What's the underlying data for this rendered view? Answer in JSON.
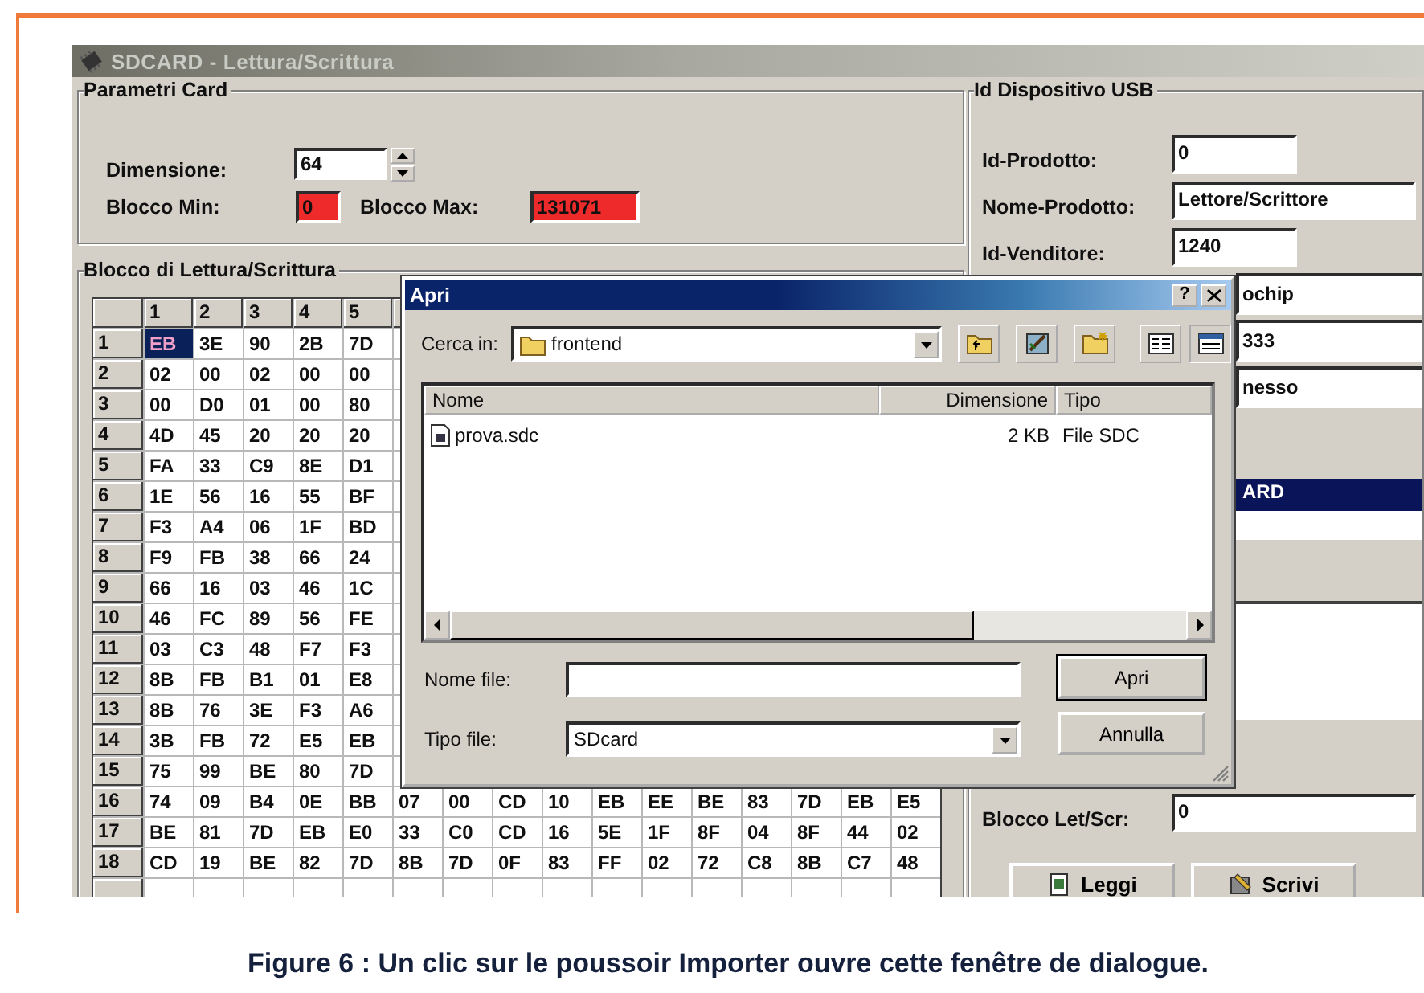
{
  "window": {
    "title": "SDCARD - Lettura/Scrittura"
  },
  "card_params": {
    "title": "Parametri Card",
    "fields": [
      {
        "kind": "spin",
        "label": "Dimensione:",
        "value": "64"
      },
      {
        "kind": "alert",
        "label": "Blocco Min:",
        "value": "0"
      },
      {
        "kind": "alert",
        "label": "Blocco Max:",
        "value": "131071"
      }
    ]
  },
  "data_block": {
    "title": "Blocco di Lettura/Scrittura",
    "columns": [
      "1",
      "2",
      "3",
      "4",
      "5"
    ],
    "rows": [
      {
        "label": "1",
        "cells": [
          "EB",
          "3E",
          "90",
          "2B",
          "7D"
        ],
        "selected": [
          true,
          false,
          false,
          false,
          false
        ]
      },
      {
        "label": "2",
        "cells": [
          "02",
          "00",
          "02",
          "00",
          "00"
        ]
      },
      {
        "label": "3",
        "cells": [
          "00",
          "D0",
          "01",
          "00",
          "80"
        ]
      },
      {
        "label": "4",
        "cells": [
          "4D",
          "45",
          "20",
          "20",
          "20"
        ]
      },
      {
        "label": "5",
        "cells": [
          "FA",
          "33",
          "C9",
          "8E",
          "D1"
        ]
      },
      {
        "label": "6",
        "cells": [
          "1E",
          "56",
          "16",
          "55",
          "BF"
        ]
      },
      {
        "label": "7",
        "cells": [
          "F3",
          "A4",
          "06",
          "1F",
          "BD"
        ]
      },
      {
        "label": "8",
        "cells": [
          "F9",
          "FB",
          "38",
          "66",
          "24"
        ]
      },
      {
        "label": "9",
        "cells": [
          "66",
          "16",
          "03",
          "46",
          "1C"
        ]
      },
      {
        "label": "10",
        "cells": [
          "46",
          "FC",
          "89",
          "56",
          "FE"
        ]
      },
      {
        "label": "11",
        "cells": [
          "03",
          "C3",
          "48",
          "F7",
          "F3"
        ]
      },
      {
        "label": "12",
        "cells": [
          "8B",
          "FB",
          "B1",
          "01",
          "E8"
        ]
      },
      {
        "label": "13",
        "cells": [
          "8B",
          "76",
          "3E",
          "F3",
          "A6"
        ]
      },
      {
        "label": "14",
        "cells": [
          "3B",
          "FB",
          "72",
          "E5",
          "EB"
        ]
      },
      {
        "label": "15",
        "cells": [
          "75",
          "99",
          "BE",
          "80",
          "7D"
        ]
      },
      {
        "label": "16",
        "cells": [
          "74",
          "09",
          "B4",
          "0E",
          "BB",
          "07",
          "00",
          "CD",
          "10",
          "EB",
          "EE",
          "BE",
          "83",
          "7D",
          "EB",
          "E5"
        ]
      },
      {
        "label": "17",
        "cells": [
          "BE",
          "81",
          "7D",
          "EB",
          "E0",
          "33",
          "C0",
          "CD",
          "16",
          "5E",
          "1F",
          "8F",
          "04",
          "8F",
          "44",
          "02"
        ]
      },
      {
        "label": "18",
        "cells": [
          "CD",
          "19",
          "BE",
          "82",
          "7D",
          "8B",
          "7D",
          "0F",
          "83",
          "FF",
          "02",
          "72",
          "C8",
          "8B",
          "C7",
          "48"
        ]
      }
    ]
  },
  "usb": {
    "title": "Id Dispositivo USB",
    "fields": [
      {
        "label": "Id-Prodotto:",
        "value": "0"
      },
      {
        "label": "Nome-Prodotto:",
        "value": "Lettore/Scrittore"
      },
      {
        "label": "Id-Venditore:",
        "value": "1240"
      }
    ],
    "hidden_fields": [
      "ochip",
      "333",
      "nesso"
    ],
    "section_bar": "ARD",
    "block": {
      "label": "Blocco Let/Scr:",
      "value": "0"
    },
    "buttons": [
      {
        "kind": "read",
        "label": "Leggi"
      },
      {
        "kind": "write",
        "label": "Scrivi"
      }
    ]
  },
  "dialog": {
    "title": "Apri",
    "help": "?",
    "look_in": {
      "label": "Cerca in:",
      "value": "frontend"
    },
    "columns": [
      "Nome",
      "Dimensione",
      "Tipo"
    ],
    "files": [
      {
        "name": "prova.sdc",
        "size": "2 KB",
        "type": "File SDC"
      }
    ],
    "file_name": {
      "label": "Nome file:"
    },
    "file_type": {
      "label": "Tipo file:",
      "value": "SDcard"
    },
    "buttons": [
      {
        "label": "Apri",
        "default": true
      },
      {
        "label": "Annulla",
        "default": false
      }
    ]
  },
  "caption": "Figure 6 : Un clic sur le poussoir Importer ouvre cette fenêtre de dialogue."
}
